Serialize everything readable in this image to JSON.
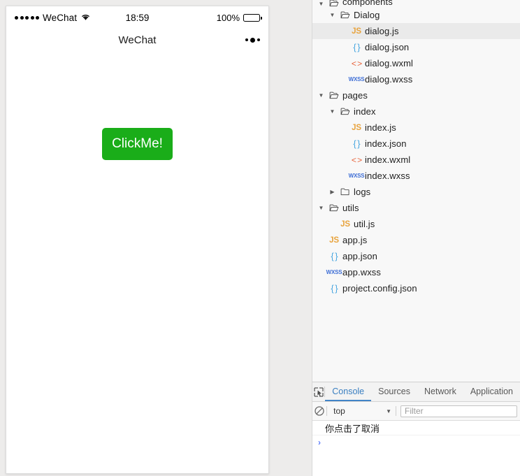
{
  "simulator": {
    "status_bar": {
      "carrier": "WeChat",
      "signal_icon": "signal-dots-icon",
      "wifi_icon": "wifi-icon",
      "time": "18:59",
      "battery_percent": "100%",
      "battery_icon": "battery-full-icon"
    },
    "nav_bar": {
      "title": "WeChat",
      "menu_icon": "more-dots-icon"
    },
    "page": {
      "button_label": "ClickMe!",
      "button_color": "#1aad19"
    }
  },
  "devtools": {
    "file_tree": [
      {
        "label": "components",
        "type": "folder",
        "state": "open",
        "depth": 0,
        "selected": false,
        "clipped": true
      },
      {
        "label": "Dialog",
        "type": "folder",
        "state": "open",
        "depth": 1,
        "selected": false
      },
      {
        "label": "dialog.js",
        "type": "js",
        "state": "leaf",
        "depth": 2,
        "selected": true
      },
      {
        "label": "dialog.json",
        "type": "json",
        "state": "leaf",
        "depth": 2,
        "selected": false
      },
      {
        "label": "dialog.wxml",
        "type": "wxml",
        "state": "leaf",
        "depth": 2,
        "selected": false
      },
      {
        "label": "dialog.wxss",
        "type": "wxss",
        "state": "leaf",
        "depth": 2,
        "selected": false
      },
      {
        "label": "pages",
        "type": "folder",
        "state": "open",
        "depth": 0,
        "selected": false
      },
      {
        "label": "index",
        "type": "folder",
        "state": "open",
        "depth": 1,
        "selected": false
      },
      {
        "label": "index.js",
        "type": "js",
        "state": "leaf",
        "depth": 2,
        "selected": false
      },
      {
        "label": "index.json",
        "type": "json",
        "state": "leaf",
        "depth": 2,
        "selected": false
      },
      {
        "label": "index.wxml",
        "type": "wxml",
        "state": "leaf",
        "depth": 2,
        "selected": false
      },
      {
        "label": "index.wxss",
        "type": "wxss",
        "state": "leaf",
        "depth": 2,
        "selected": false
      },
      {
        "label": "logs",
        "type": "folder",
        "state": "closed",
        "depth": 1,
        "selected": false
      },
      {
        "label": "utils",
        "type": "folder",
        "state": "open",
        "depth": 0,
        "selected": false
      },
      {
        "label": "util.js",
        "type": "js",
        "state": "leaf",
        "depth": 1,
        "selected": false
      },
      {
        "label": "app.js",
        "type": "js",
        "state": "leaf",
        "depth": 0,
        "selected": false
      },
      {
        "label": "app.json",
        "type": "json",
        "state": "leaf",
        "depth": 0,
        "selected": false
      },
      {
        "label": "app.wxss",
        "type": "wxss",
        "state": "leaf",
        "depth": 0,
        "selected": false
      },
      {
        "label": "project.config.json",
        "type": "json",
        "state": "leaf",
        "depth": 0,
        "selected": false
      }
    ],
    "tabbar": {
      "inspect_icon": "inspect-element-icon",
      "tabs": [
        {
          "label": "Console",
          "active": true
        },
        {
          "label": "Sources",
          "active": false
        },
        {
          "label": "Network",
          "active": false
        },
        {
          "label": "Application",
          "active": false
        }
      ]
    },
    "console_toolbar": {
      "clear_icon": "clear-console-icon",
      "context": "top",
      "caret_icon": "chevron-down-icon",
      "filter_placeholder": "Filter",
      "filter_value": ""
    },
    "console": {
      "messages": [
        "你点击了取消"
      ],
      "prompt": "›"
    }
  }
}
